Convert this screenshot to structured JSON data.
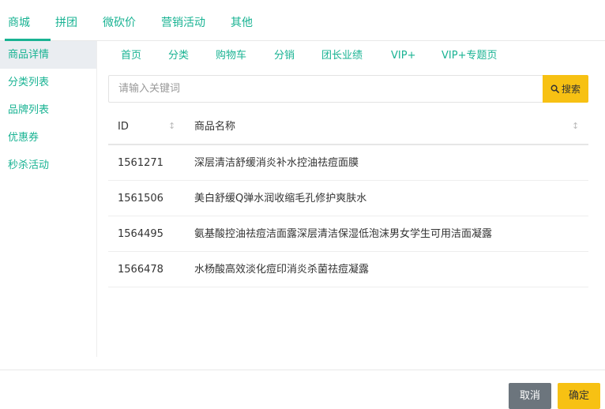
{
  "top_tabs": [
    "商城",
    "拼团",
    "微砍价",
    "营销活动",
    "其他"
  ],
  "sidebar": [
    "商品详情",
    "分类列表",
    "品牌列表",
    "优惠券",
    "秒杀活动"
  ],
  "sub_tabs": [
    "首页",
    "分类",
    "购物车",
    "分销",
    "团长业绩",
    "VIP+",
    "VIP+专题页"
  ],
  "search": {
    "placeholder": "请输入关键词",
    "button": "搜索",
    "icon": "search-icon"
  },
  "table": {
    "columns": [
      "ID",
      "商品名称"
    ],
    "sort_icon": "↕",
    "rows": [
      {
        "id": "1561271",
        "name": "深层清洁舒缓消炎补水控油祛痘面膜"
      },
      {
        "id": "1561506",
        "name": "美白舒缓Q弹水润收缩毛孔修护爽肤水"
      },
      {
        "id": "1564495",
        "name": "氨基酸控油祛痘洁面露深层清洁保湿低泡沫男女学生可用洁面凝露"
      },
      {
        "id": "1566478",
        "name": "水杨酸高效淡化痘印消炎杀菌祛痘凝露"
      }
    ]
  },
  "footer": {
    "cancel": "取消",
    "confirm": "确定"
  },
  "colors": {
    "accent": "#19b393",
    "button": "#f7c113",
    "cancel": "#6c757d"
  }
}
